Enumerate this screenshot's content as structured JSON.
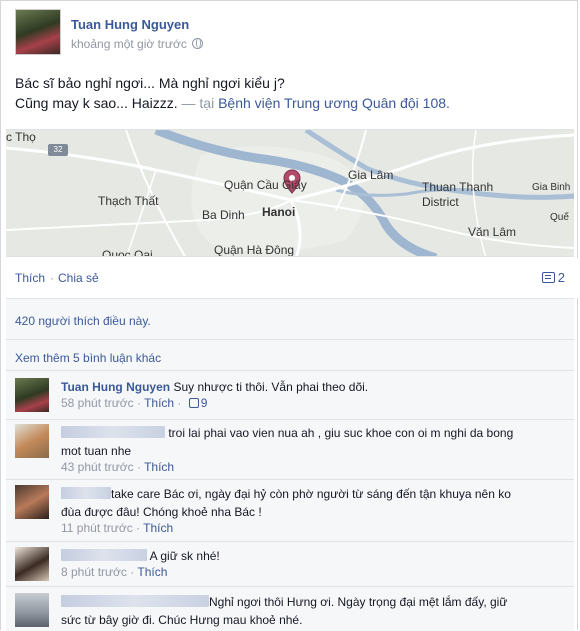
{
  "post": {
    "author": "Tuan Hung Nguyen",
    "time": "khoảng một giờ trước",
    "status_line1": "Bác sĩ bảo nghỉ ngơi... Mà nghỉ ngơi kiểu j?",
    "status_line2_prefix": "Cũng may k sao... Haizzz.",
    "status_tai": "— tại",
    "place": "Bệnh viện Trung ương Quân đội 108."
  },
  "map": {
    "labels": {
      "cthọ": "c Thọ",
      "road": "32",
      "quan_cau_giay": "Quận Cầu Giấy",
      "gia_lam": "Gia Lâm",
      "thuan_thanh": "Thuan Thanh",
      "district": "District",
      "gia_binh": "Gia Binh",
      "thach_that": "Thạch Thất",
      "ba_dinh": "Ba Dinh",
      "hanoi": "Hanoi",
      "que": "Quế",
      "van_lam": "Văn Lâm",
      "quoc_oai": "Quoc Oai",
      "quan_ha_dong": "Quận Hà Đông"
    }
  },
  "actions": {
    "like": "Thích",
    "share": "Chia sẻ",
    "separator": "·",
    "comment_count": "2"
  },
  "likes_text": "420 người thích điều này.",
  "more_comments": "Xem thêm 5 bình luận khác",
  "comments": [
    {
      "author": "Tuan Hung Nguyen",
      "text": " Suy nhược ti thôi. Vẫn phai theo dõi.",
      "time": "58 phút trước",
      "like": "Thích",
      "likes": "9"
    },
    {
      "text_line1": "troi lai phai vao vien nua ah , giu suc khoe con oi m nghi da bong",
      "text_line2": "mot tuan nhe",
      "time": "43 phút trước",
      "like": "Thích"
    },
    {
      "text_line1": "take care Bác ơi, ngày đại hỷ còn phờ người từ sáng đến tận khuya nên ko",
      "text_line2": "đùa được đâu! Chóng khoẻ nha Bác !",
      "time": "11 phút trước",
      "like": "Thích"
    },
    {
      "text_line1": "A giữ sk nhé!",
      "time": "8 phút trước",
      "like": "Thích"
    },
    {
      "text_line1": "Nghỉ ngơi thôi Hưng ơi. Ngày trọng đại mệt lắm đấy, giữ",
      "text_line2": "sức từ bây giờ đi. Chúc Hưng mau khoẻ nhé."
    }
  ]
}
